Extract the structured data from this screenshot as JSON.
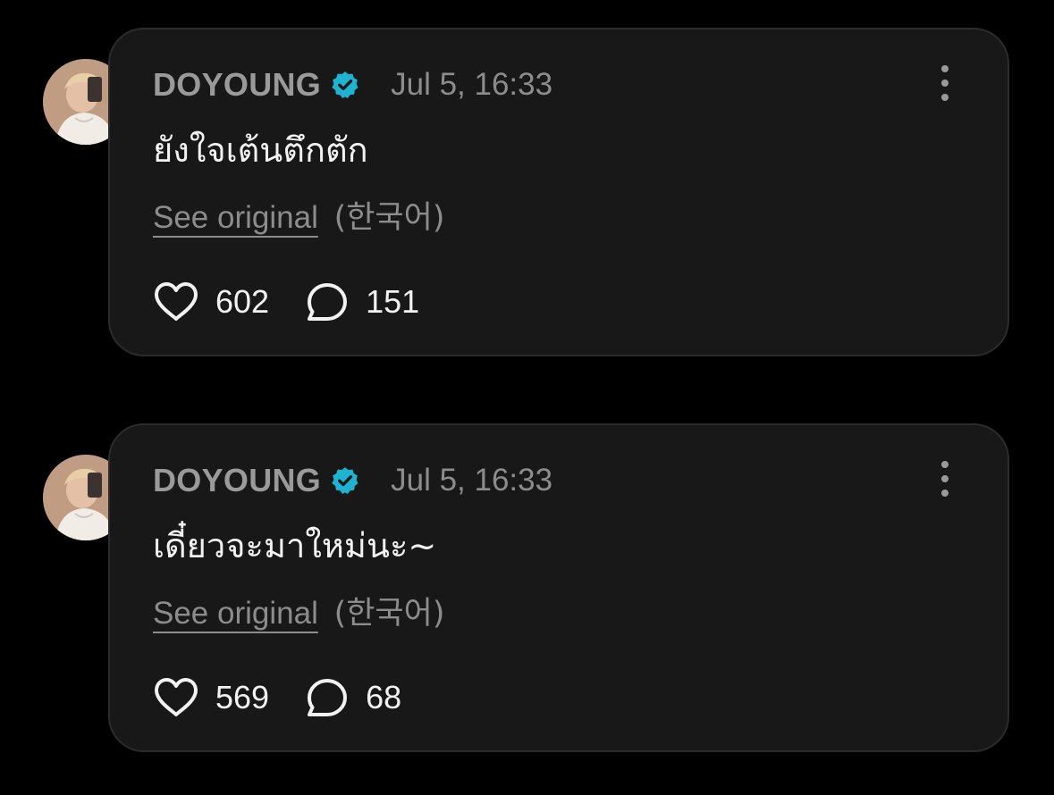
{
  "colors": {
    "background": "#000000",
    "card": "#181818",
    "verified_badge": "#1db4d1",
    "muted_text": "#8c8c8c",
    "primary_text": "#f2f2f2"
  },
  "posts": [
    {
      "username": "DOYOUNG",
      "verified": true,
      "timestamp": "Jul 5, 16:33",
      "text": "ยังใจเต้นตึกตัก",
      "see_original_label": "See original",
      "original_language": "(한국어)",
      "likes": "602",
      "comments": "151",
      "like_icon": "heart-icon",
      "comment_icon": "speech-bubble-icon",
      "menu_icon": "more-vertical-icon"
    },
    {
      "username": "DOYOUNG",
      "verified": true,
      "timestamp": "Jul 5, 16:33",
      "text": "เดี๋ยวจะมาใหม่นะ~",
      "see_original_label": "See original",
      "original_language": "(한국어)",
      "likes": "569",
      "comments": "68",
      "like_icon": "heart-icon",
      "comment_icon": "speech-bubble-icon",
      "menu_icon": "more-vertical-icon"
    }
  ]
}
